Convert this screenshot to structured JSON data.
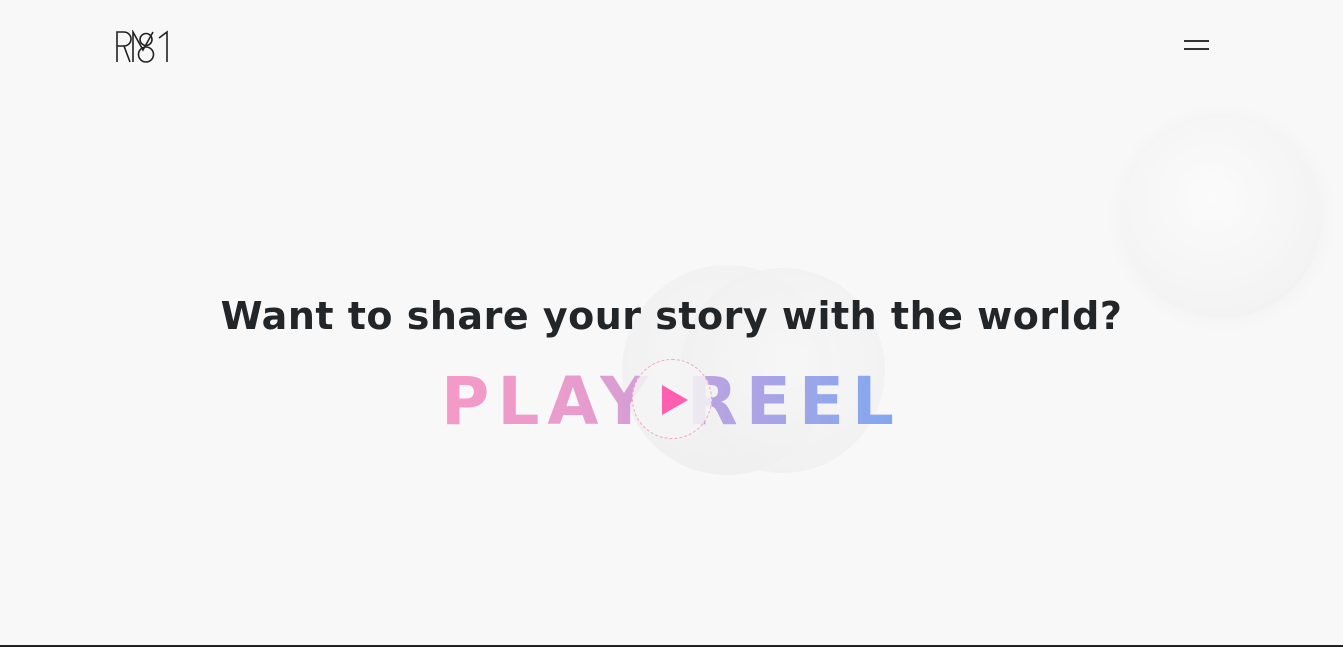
{
  "header": {
    "logo_alt": "RM81 logo",
    "menu_label": "menu"
  },
  "hero": {
    "headline": "Want to share your story with the world?",
    "play_reel": "PLAY REEL"
  },
  "colors": {
    "background": "#f8f8f8",
    "headline": "#222629",
    "gradient_start": "#f59ac7",
    "gradient_end": "#7fa8f1",
    "play_icon": "#ff5fb0"
  },
  "icons": {
    "menu": "hamburger-icon",
    "play": "play-icon"
  }
}
